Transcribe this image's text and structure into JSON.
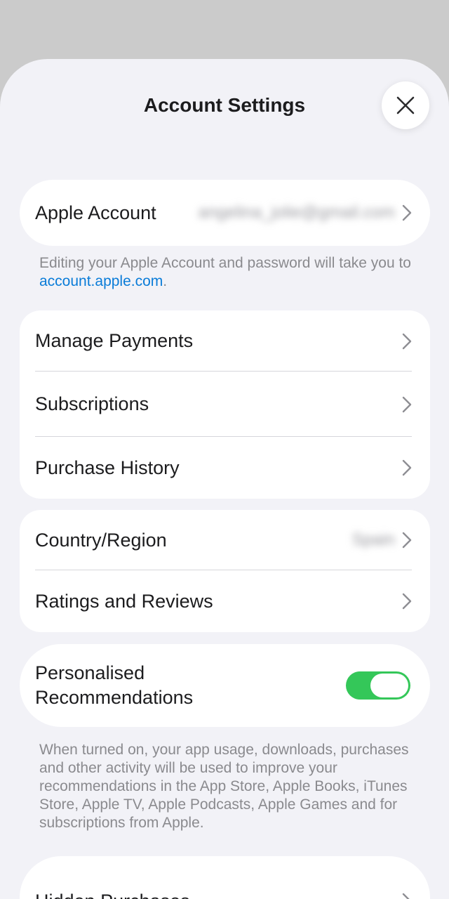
{
  "header": {
    "title": "Account Settings",
    "close_icon": "close-icon"
  },
  "account": {
    "label": "Apple Account",
    "value": "angelina_jolie@gmail.com",
    "note_prefix": "Editing your Apple Account and password will take you to ",
    "note_link": "account.apple.com",
    "note_suffix": "."
  },
  "purchases_group": [
    {
      "label": "Manage Payments"
    },
    {
      "label": "Subscriptions"
    },
    {
      "label": "Purchase History"
    }
  ],
  "region_group": {
    "country_label": "Country/Region",
    "country_value": "Spain",
    "ratings_label": "Ratings and Reviews"
  },
  "personalised": {
    "label_line1": "Personalised",
    "label_line2": "Recommendations",
    "enabled": true,
    "note": "When turned on, your app usage, downloads, purchases and other activity will be used to improve your recommendations in the App Store, Apple Books, iTunes Store, Apple TV, Apple Podcasts, Apple Games and for subscriptions from Apple."
  },
  "hidden": {
    "label": "Hidden Purchases"
  },
  "colors": {
    "accent_link": "#0a7cd8",
    "toggle_on": "#34c759",
    "sheet_bg": "#f2f2f7"
  }
}
